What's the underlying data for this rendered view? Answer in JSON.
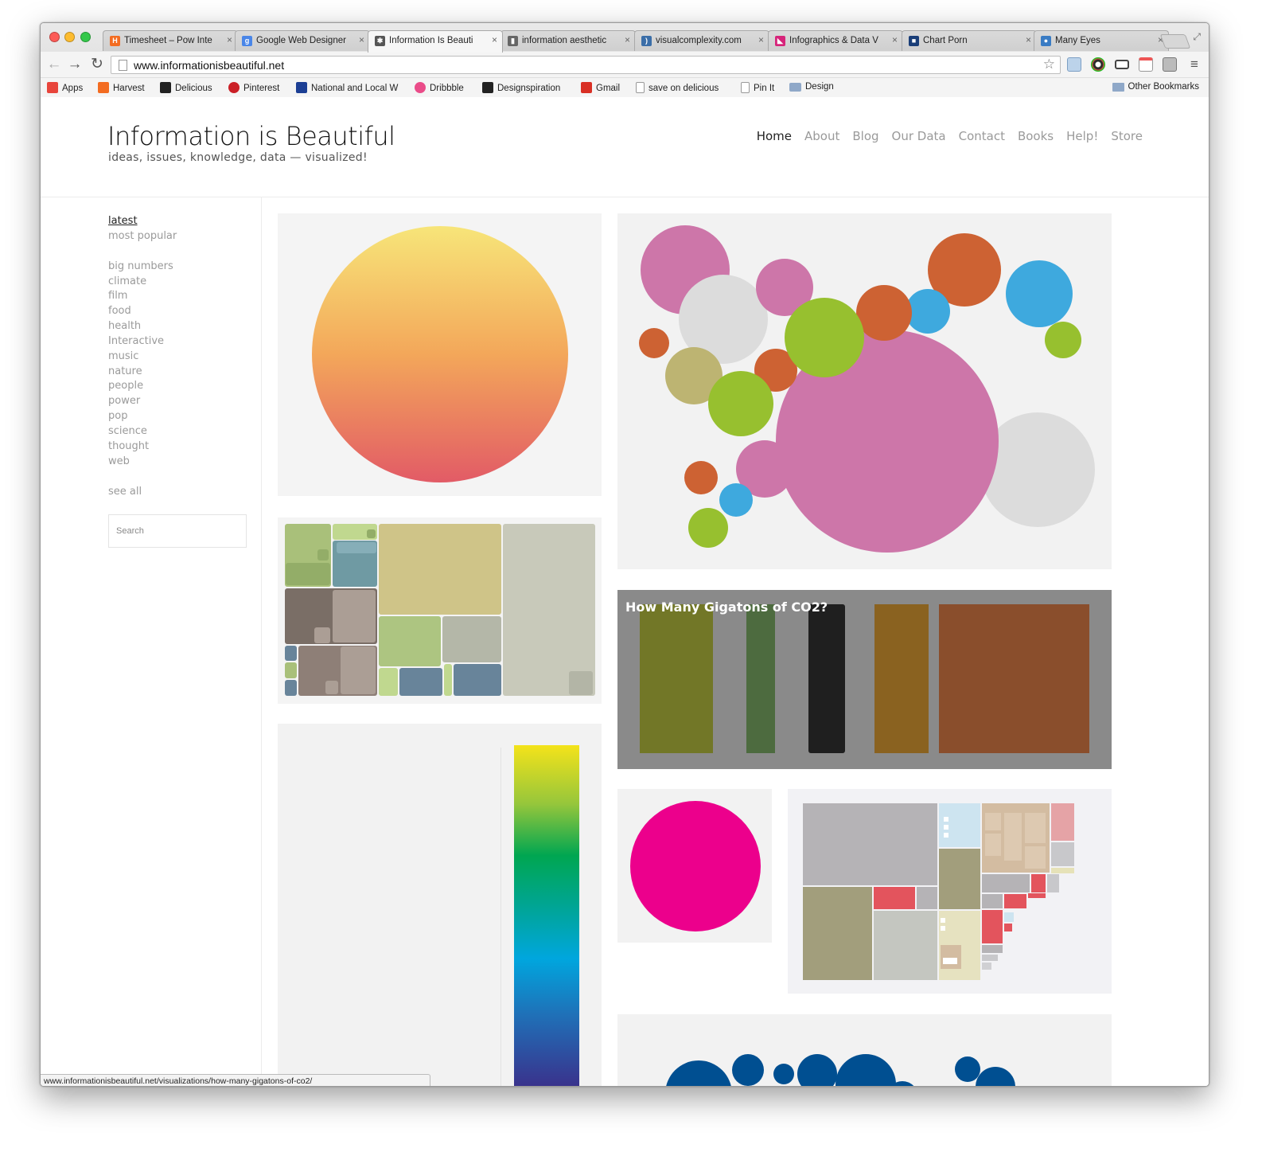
{
  "browser": {
    "tabs": [
      {
        "label": "Timesheet – Pow Inte",
        "fav": "H",
        "color": "#f36c21"
      },
      {
        "label": "Google Web Designer",
        "fav": "g",
        "color": "#4a86e8"
      },
      {
        "label": "Information Is Beauti",
        "fav": "✱",
        "color": "#555555"
      },
      {
        "label": "information aesthetic",
        "fav": "▮",
        "color": "#666666"
      },
      {
        "label": "visualcomplexity.com",
        "fav": ")",
        "color": "#3b6ea8"
      },
      {
        "label": "Infographics & Data V",
        "fav": "◣",
        "color": "#d6247a"
      },
      {
        "label": "Chart Porn",
        "fav": "■",
        "color": "#1a3e78"
      },
      {
        "label": "Many Eyes",
        "fav": "●",
        "color": "#3a7cc4"
      }
    ],
    "url": "www.informationisbeautiful.net",
    "bookmarks": [
      {
        "label": "Apps",
        "icon": "apps-grid-icon",
        "color": "#e8453c"
      },
      {
        "label": "Harvest",
        "icon": "harvest-icon",
        "color": "#f36c21"
      },
      {
        "label": "Delicious",
        "icon": "delicious-icon",
        "color": "#222222"
      },
      {
        "label": "Pinterest",
        "icon": "pinterest-icon",
        "color": "#cb2027"
      },
      {
        "label": "National and Local W",
        "icon": "twc-icon",
        "color": "#1c3f94"
      },
      {
        "label": "Dribbble",
        "icon": "dribbble-icon",
        "color": "#ea4c89"
      },
      {
        "label": "Designspiration",
        "icon": "designspiration-icon",
        "color": "#222222"
      },
      {
        "label": "Gmail",
        "icon": "gmail-icon",
        "color": "#d93025"
      },
      {
        "label": "save on delicious",
        "icon": "page-icon",
        "color": "#ffffff"
      },
      {
        "label": "Pin It",
        "icon": "page-icon",
        "color": "#ffffff"
      },
      {
        "label": "Design",
        "icon": "folder-icon",
        "color": "#8fa8c8"
      }
    ],
    "other_bookmarks": "Other Bookmarks",
    "status_url": "www.informationisbeautiful.net/visualizations/how-many-gigatons-of-co2/"
  },
  "site": {
    "title": "Information is Beautiful",
    "subtitle": "ideas, issues, knowledge, data — visualized!",
    "nav": [
      "Home",
      "About",
      "Blog",
      "Our Data",
      "Contact",
      "Books",
      "Help!",
      "Store"
    ],
    "sidebar_sort": [
      "latest",
      "most popular"
    ],
    "sidebar_categories": [
      "big numbers",
      "climate",
      "film",
      "food",
      "health",
      "Interactive",
      "music",
      "nature",
      "people",
      "power",
      "pop",
      "science",
      "thought",
      "web"
    ],
    "see_all": "see all",
    "search_placeholder": "Search",
    "co2_title": "How Many Gigatons of CO2?"
  },
  "colors": {
    "pink": "#cd76a9",
    "grey_bubble": "#dcdcdc",
    "green_bubble": "#97c02f",
    "orange_bubble": "#cd6233",
    "blue_bubble": "#3ea9de",
    "tan_bubble": "#bdb472",
    "magenta": "#ec008c",
    "co2_bg": "#8a8a8a",
    "navy_bubble": "#004f91"
  }
}
